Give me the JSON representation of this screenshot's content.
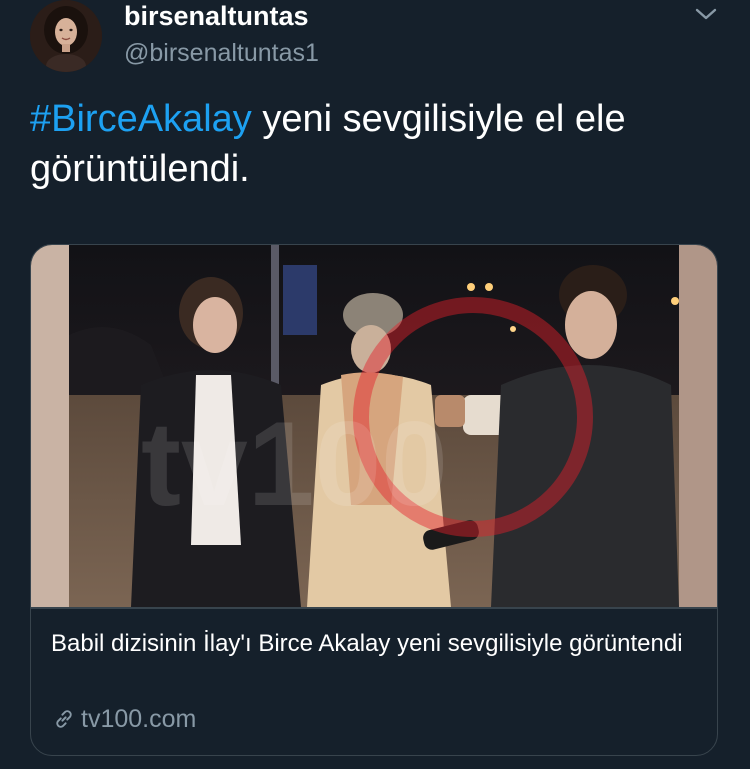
{
  "author": {
    "display_name": "birsenaltuntas",
    "handle": "@birsenaltuntas1",
    "avatar_icon": "profile-photo"
  },
  "tweet": {
    "hashtag": "#BirceAkalay",
    "text_rest": " yeni sevgilisiyle el ele görüntülendi."
  },
  "card": {
    "title": "Babil dizisinin İlay'ı Birce Akalay yeni sevgilisiyle görüntendi",
    "domain": "tv100.com",
    "image_watermark": "tv100"
  },
  "colors": {
    "background": "#15202b",
    "primary_text": "#ffffff",
    "secondary_text": "#8899a6",
    "accent": "#1da1f2",
    "border": "#38444d"
  },
  "icons": {
    "menu": "chevron-down-icon",
    "link": "link-icon"
  }
}
